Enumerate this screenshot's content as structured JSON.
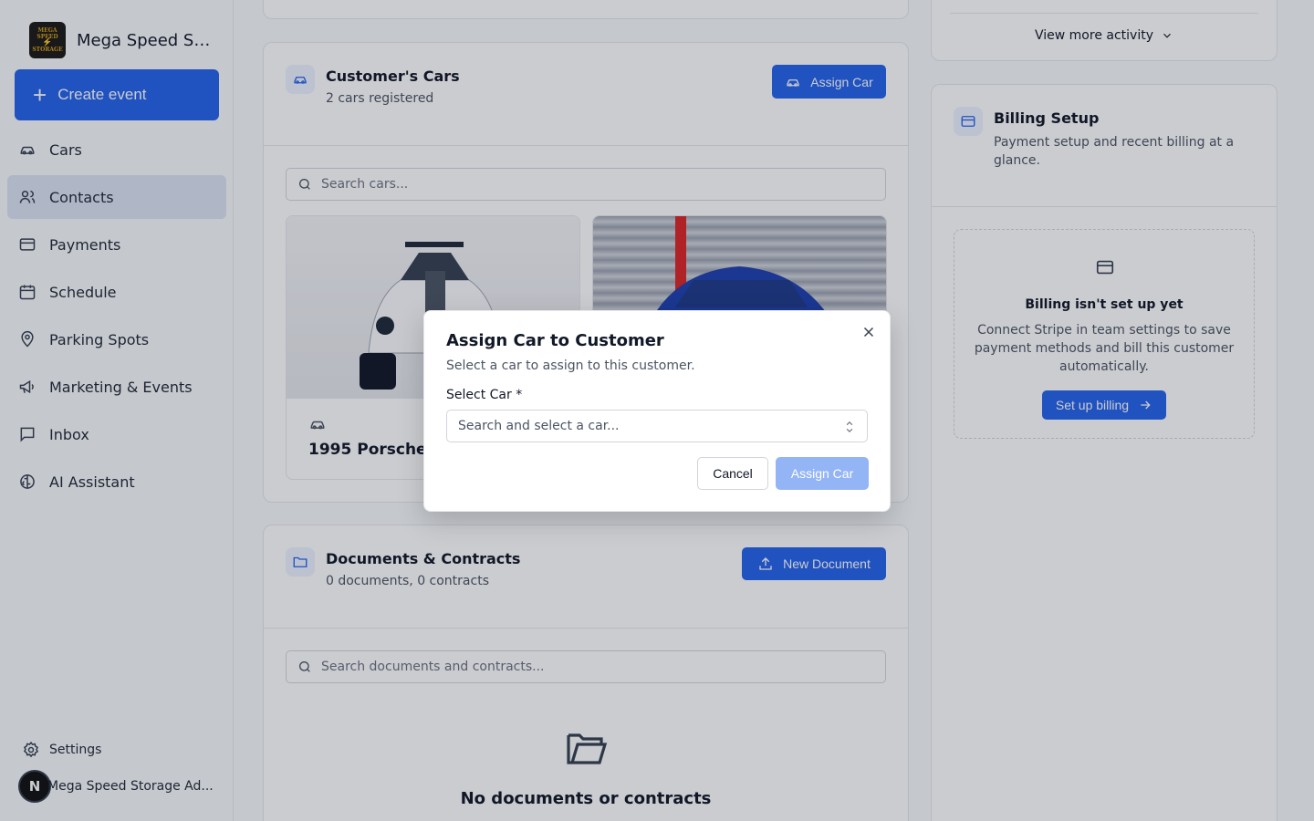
{
  "sidebar": {
    "brand_name": "Mega Speed St...",
    "logo_text": [
      "MEGA SPEED",
      "STORAGE"
    ],
    "create_label": "Create event",
    "items": [
      {
        "label": "Cars",
        "icon": "car-icon"
      },
      {
        "label": "Contacts",
        "icon": "users-icon",
        "active": true
      },
      {
        "label": "Payments",
        "icon": "credit-card-icon"
      },
      {
        "label": "Schedule",
        "icon": "calendar-icon"
      },
      {
        "label": "Parking Spots",
        "icon": "map-pin-icon"
      },
      {
        "label": "Marketing & Events",
        "icon": "megaphone-icon"
      },
      {
        "label": "Inbox",
        "icon": "message-icon"
      },
      {
        "label": "AI Assistant",
        "icon": "brain-icon"
      }
    ],
    "settings_label": "Settings",
    "user_initial": "N",
    "user_name": "Mega Speed Storage Ad..."
  },
  "cars_card": {
    "title": "Customer's Cars",
    "subtitle": "2 cars registered",
    "assign_label": "Assign Car",
    "search_placeholder": "Search cars...",
    "car1_title": "1995 Porsche 9"
  },
  "docs_card": {
    "title": "Documents & Contracts",
    "subtitle": "0 documents, 0 contracts",
    "new_label": "New Document",
    "search_placeholder": "Search documents and contracts...",
    "empty_title": "No documents or contracts"
  },
  "activity": {
    "view_more": "View more activity"
  },
  "billing": {
    "title": "Billing Setup",
    "subtitle": "Payment setup and recent billing at a glance.",
    "empty_title": "Billing isn't set up yet",
    "empty_text": "Connect Stripe in team settings to save payment methods and bill this customer automatically.",
    "setup_label": "Set up billing"
  },
  "dialog": {
    "title": "Assign Car to Customer",
    "subtitle": "Select a car to assign to this customer.",
    "label": "Select Car *",
    "select_placeholder": "Search and select a car...",
    "cancel_label": "Cancel",
    "assign_label": "Assign Car"
  },
  "colors": {
    "primary": "#2563eb",
    "primary_disabled": "#93b4f5",
    "active_nav": "#dbe4f3"
  }
}
